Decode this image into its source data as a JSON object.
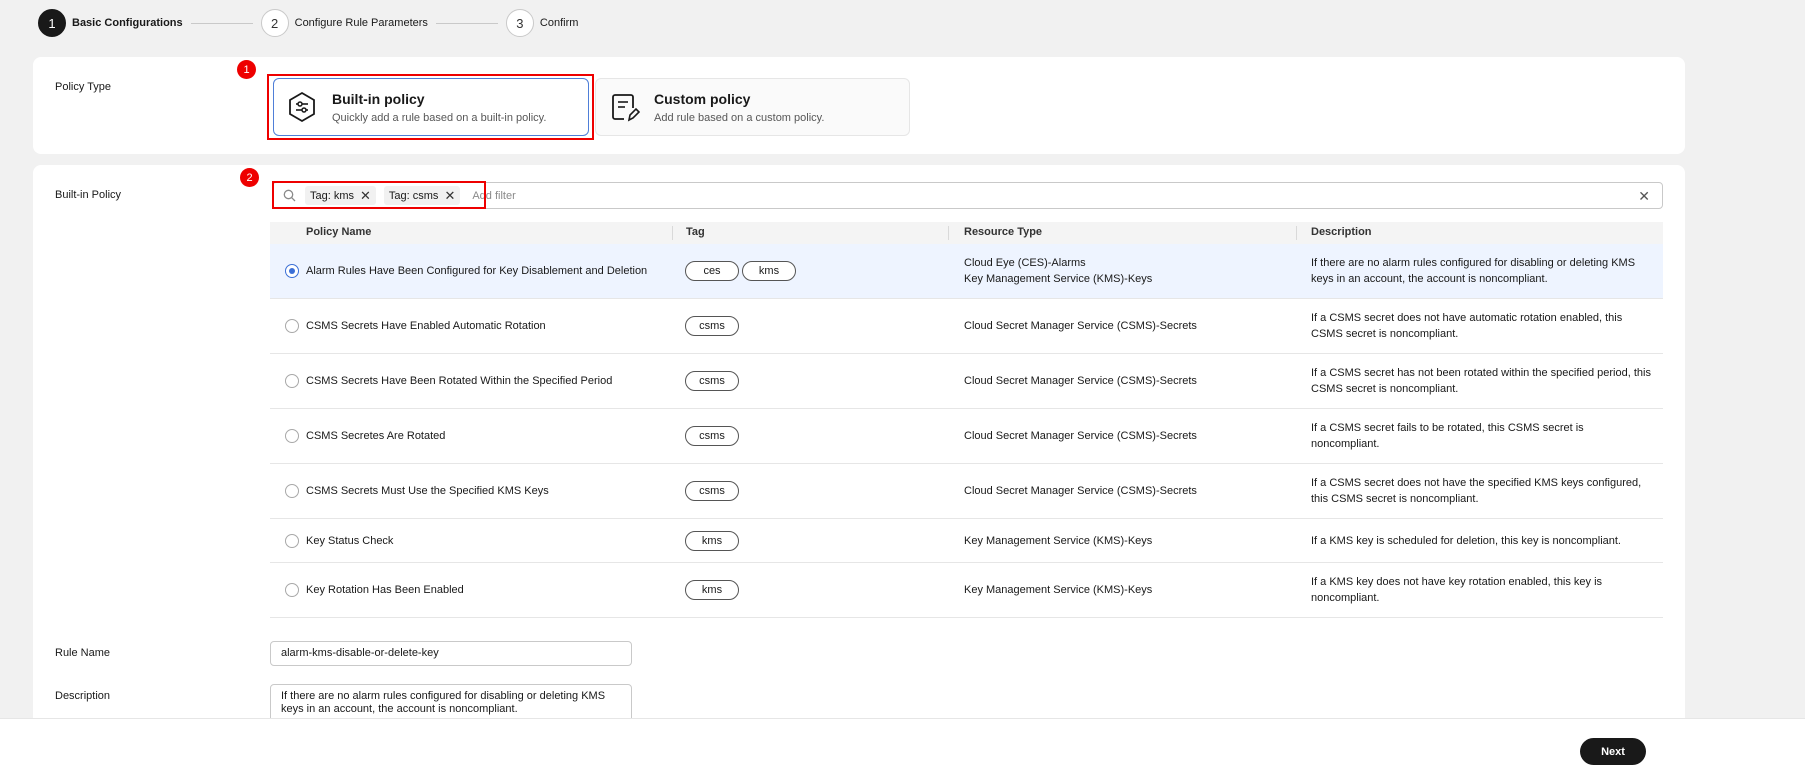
{
  "stepper": {
    "steps": [
      {
        "num": "1",
        "label": "Basic Configurations"
      },
      {
        "num": "2",
        "label": "Configure Rule Parameters"
      },
      {
        "num": "3",
        "label": "Confirm"
      }
    ]
  },
  "policy_type": {
    "label": "Policy Type",
    "badge": "1",
    "builtin": {
      "title": "Built-in policy",
      "desc": "Quickly add a rule based on a built-in policy."
    },
    "custom": {
      "title": "Custom policy",
      "desc": "Add rule based on a custom policy."
    }
  },
  "builtin_policy": {
    "label": "Built-in Policy",
    "badge": "2",
    "filter": {
      "chips": [
        "Tag: kms",
        "Tag: csms"
      ],
      "add_filter": "Add filter"
    },
    "columns": [
      "Policy Name",
      "Tag",
      "Resource Type",
      "Description"
    ],
    "rows": [
      {
        "name": "Alarm Rules Have Been Configured for Key Disablement and Deletion",
        "tags": [
          "ces",
          "kms"
        ],
        "resource1": "Cloud Eye (CES)-Alarms",
        "resource2": "Key Management Service (KMS)-Keys",
        "desc1": "If there are no alarm rules configured for disabling or deleting KMS",
        "desc2": "keys in an account, the account is noncompliant.",
        "selected": true
      },
      {
        "name": "CSMS Secrets Have Enabled Automatic Rotation",
        "tags": [
          "csms"
        ],
        "resource1": "Cloud Secret Manager Service (CSMS)-Secrets",
        "resource2": "",
        "desc1": "If a CSMS secret does not have automatic rotation enabled, this",
        "desc2": "CSMS secret is noncompliant.",
        "selected": false
      },
      {
        "name": "CSMS Secrets Have Been Rotated Within the Specified Period",
        "tags": [
          "csms"
        ],
        "resource1": "Cloud Secret Manager Service (CSMS)-Secrets",
        "resource2": "",
        "desc1": "If a CSMS secret has not been rotated within the specified period, this",
        "desc2": "CSMS secret is noncompliant.",
        "selected": false
      },
      {
        "name": "CSMS Secretes Are Rotated",
        "tags": [
          "csms"
        ],
        "resource1": "Cloud Secret Manager Service (CSMS)-Secrets",
        "resource2": "",
        "desc1": "If a CSMS secret fails to be rotated, this CSMS secret is",
        "desc2": "noncompliant.",
        "selected": false
      },
      {
        "name": "CSMS Secrets Must Use the Specified KMS Keys",
        "tags": [
          "csms"
        ],
        "resource1": "Cloud Secret Manager Service (CSMS)-Secrets",
        "resource2": "",
        "desc1": "If a CSMS secret does not have the specified KMS keys configured,",
        "desc2": "this CSMS secret is noncompliant.",
        "selected": false
      },
      {
        "name": "Key Status Check",
        "tags": [
          "kms"
        ],
        "resource1": "Key Management Service (KMS)-Keys",
        "resource2": "",
        "desc1": "If a KMS key is scheduled for deletion, this key is noncompliant.",
        "desc2": "",
        "selected": false
      },
      {
        "name": "Key Rotation Has Been Enabled",
        "tags": [
          "kms"
        ],
        "resource1": "Key Management Service (KMS)-Keys",
        "resource2": "",
        "desc1": "If a KMS key does not have key rotation enabled, this key is",
        "desc2": "noncompliant.",
        "selected": false
      }
    ]
  },
  "rule_name": {
    "label": "Rule Name",
    "value": "alarm-kms-disable-or-delete-key"
  },
  "description": {
    "label": "Description",
    "line1": "If there are no alarm rules configured for disabling or deleting KMS",
    "line2": "keys in an account, the account is noncompliant."
  },
  "footer": {
    "next_label": "Next"
  },
  "colors": {
    "accent": "#3b6fd6",
    "annotation": "#e00000",
    "primary_button": "#191919"
  }
}
